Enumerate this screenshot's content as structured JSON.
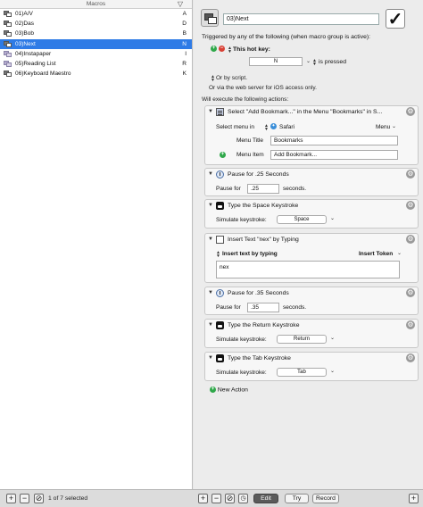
{
  "macros": {
    "header": "Macros",
    "sort_icon": "filter-triangle-icon",
    "items": [
      {
        "name": "01)A/V",
        "key": "A",
        "icon": "macro-icon"
      },
      {
        "name": "02)Das",
        "key": "D",
        "icon": "macro-icon"
      },
      {
        "name": "03)Bob",
        "key": "B",
        "icon": "macro-icon"
      },
      {
        "name": "03)Next",
        "key": "N",
        "icon": "macro-icon",
        "selected": true
      },
      {
        "name": "04)Instapaper",
        "key": "I",
        "icon": "document-macro-icon"
      },
      {
        "name": "05)Reading List",
        "key": "R",
        "icon": "document-macro-icon"
      },
      {
        "name": "06)Keyboard Maestro",
        "key": "K",
        "icon": "macro-icon"
      }
    ]
  },
  "editor": {
    "macro_name": "03)Next",
    "enabled_check": "✓",
    "triggers_title": "Triggered by any of the following (when macro group is active):",
    "hot_key_label": "This hot key:",
    "hot_key_value": "N",
    "hot_key_state": "is pressed",
    "or_by_script": "Or by script.",
    "web_server": "Or via the web server for iOS access only.",
    "actions_title": "Will execute the following actions:",
    "new_action": "New Action"
  },
  "actions": {
    "a1": {
      "title": "Select \"Add Bookmark...\" in the Menu \"Bookmarks\" in S...",
      "select_menu_label": "Select menu in",
      "app": "Safari",
      "menu_popup": "Menu",
      "menu_title_label": "Menu Title",
      "menu_title_value": "Bookmarks",
      "menu_item_label": "Menu Item",
      "menu_item_value": "Add Bookmark..."
    },
    "a2": {
      "title": "Pause for .25 Seconds",
      "label": "Pause for",
      "value": ".25",
      "unit": "seconds."
    },
    "a3": {
      "title": "Type the Space Keystroke",
      "label": "Simulate keystroke:",
      "value": "Space"
    },
    "a4": {
      "title": "Insert Text \"nex\" by Typing",
      "mode": "Insert text by typing",
      "token": "Insert Token",
      "text": "nex"
    },
    "a5": {
      "title": "Pause for .35 Seconds",
      "label": "Pause for",
      "value": ".35",
      "unit": "seconds."
    },
    "a6": {
      "title": "Type the Return Keystroke",
      "label": "Simulate keystroke:",
      "value": "Return"
    },
    "a7": {
      "title": "Type the Tab Keystroke",
      "label": "Simulate keystroke:",
      "value": "Tab"
    }
  },
  "bottom": {
    "selection_count": "1 of 7 selected",
    "edit": "Edit",
    "try": "Try",
    "record": "Record"
  },
  "colors": {
    "selection": "#2f7be6",
    "add": "#2fa84a",
    "remove": "#d84034"
  }
}
